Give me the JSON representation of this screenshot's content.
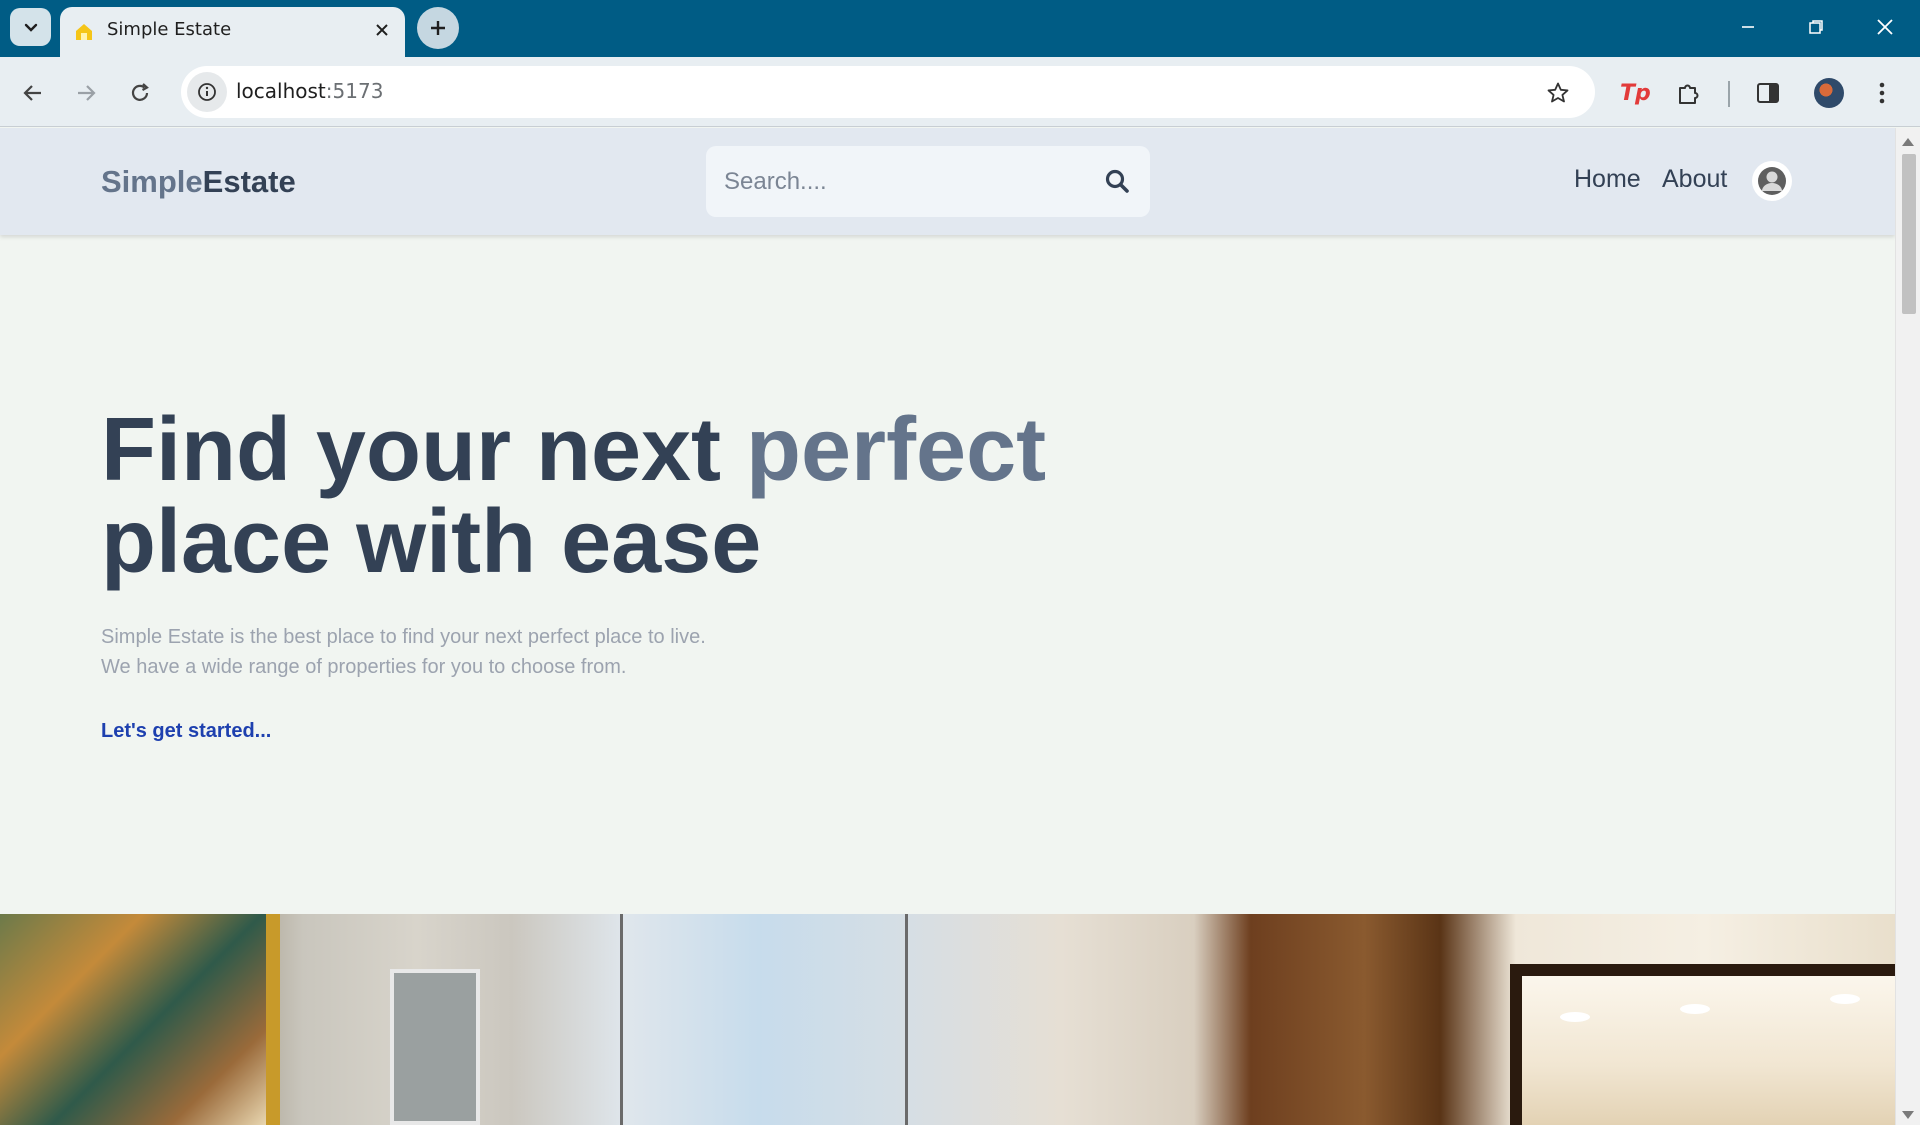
{
  "browser": {
    "tab_title": "Simple Estate",
    "url_host": "localhost",
    "url_port": ":5173",
    "extension_label": "Tp",
    "icons": [
      "tab-list-chevron-icon",
      "home-favicon-icon",
      "close-icon",
      "plus-icon",
      "minimize-icon",
      "restore-icon",
      "close-window-icon",
      "back-arrow-icon",
      "forward-arrow-icon",
      "reload-icon",
      "info-icon",
      "star-icon",
      "puzzle-icon",
      "side-panel-icon",
      "kebab-menu-icon"
    ],
    "colors": {
      "tabbar": "#005c85",
      "toolbar": "#e8eef2"
    }
  },
  "header": {
    "logo_part1": "Simple",
    "logo_part2": "Estate",
    "search_placeholder": "Search....",
    "nav": {
      "home": "Home",
      "about": "About"
    }
  },
  "hero": {
    "title_part1": "Find your next ",
    "title_accent": "perfect",
    "title_part2": "place with ease",
    "description_line1": "Simple Estate is the best place to find your next perfect place to live.",
    "description_line2": "We have a wide range of properties for you to choose from.",
    "cta": "Let's get started..."
  },
  "colors": {
    "page_bg": "#f1f5f1",
    "header_bg": "#e2e8f0",
    "text_dark": "#334155",
    "text_accent": "#64748b",
    "text_muted": "#9ca3af",
    "link": "#1e40af"
  }
}
